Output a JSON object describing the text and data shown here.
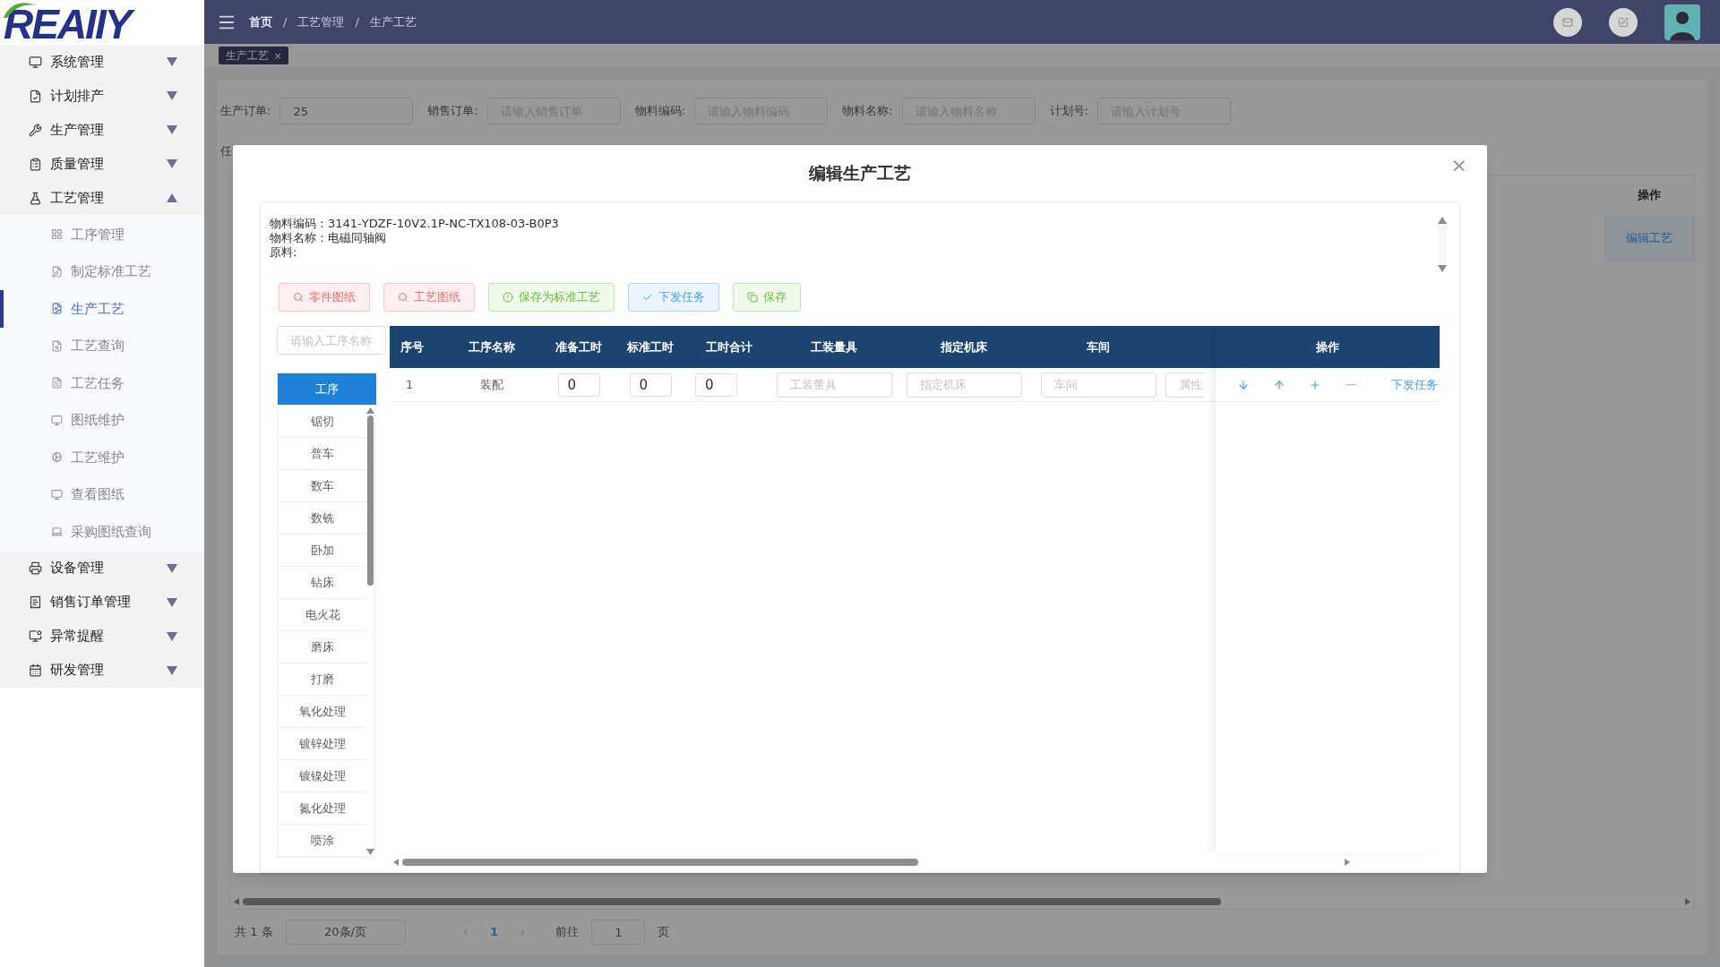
{
  "logo": {
    "text": "REAIIY"
  },
  "sidebar": {
    "items": [
      {
        "label": "系统管理",
        "expanded": false
      },
      {
        "label": "计划排产",
        "expanded": false
      },
      {
        "label": "生产管理",
        "expanded": false
      },
      {
        "label": "质量管理",
        "expanded": false
      },
      {
        "label": "工艺管理",
        "expanded": true,
        "children": [
          {
            "label": "工序管理",
            "selected": false
          },
          {
            "label": "制定标准工艺",
            "selected": false
          },
          {
            "label": "生产工艺",
            "selected": true
          },
          {
            "label": "工艺查询",
            "selected": false
          },
          {
            "label": "工艺任务",
            "selected": false
          },
          {
            "label": "图纸维护",
            "selected": false
          },
          {
            "label": "工艺维护",
            "selected": false
          },
          {
            "label": "查看图纸",
            "selected": false
          },
          {
            "label": "采购图纸查询",
            "selected": false
          }
        ]
      },
      {
        "label": "设备管理",
        "expanded": false
      },
      {
        "label": "销售订单管理",
        "expanded": false
      },
      {
        "label": "异常提醒",
        "expanded": false
      },
      {
        "label": "研发管理",
        "expanded": false
      }
    ]
  },
  "breadcrumb": {
    "items": [
      "首页",
      "工艺管理",
      "生产工艺"
    ],
    "separator": "/"
  },
  "tags": [
    {
      "label": "生产工艺",
      "close": "×",
      "selected": true
    }
  ],
  "filters": [
    {
      "label": "生产订单:",
      "value": "25"
    },
    {
      "label": "销售订单:",
      "placeholder": "请输入销售订单"
    },
    {
      "label": "物料编码:",
      "placeholder": "请输入物料编码"
    },
    {
      "label": "物料名称:",
      "placeholder": "请输入物料名称"
    },
    {
      "label": "计划号:",
      "placeholder": "请输入计划号"
    }
  ],
  "filters_row2": {
    "label": "任"
  },
  "table": {
    "columns": [
      "操作"
    ],
    "rows": [
      {
        "action": "编辑工艺"
      }
    ]
  },
  "pagination": {
    "total": "共 1 条",
    "page_size": "20条/页",
    "prev": "‹",
    "pages": [
      {
        "label": "1",
        "selected": true
      }
    ],
    "next": "›",
    "goto_label": "前往",
    "goto_value": "1",
    "goto_suffix": "页"
  },
  "dialog": {
    "title": "编辑生产工艺",
    "close": "×",
    "info_lines": [
      "物料编码：3141-YDZF-10V2.1P-NC-TX108-03-B0P3",
      "物料名称：电磁同轴阀",
      "原料:"
    ],
    "buttons": [
      {
        "label": "零件图纸",
        "kind": "danger"
      },
      {
        "label": "工艺图纸",
        "kind": "danger"
      },
      {
        "label": "保存为标准工艺",
        "kind": "success"
      },
      {
        "label": "下发任务",
        "kind": "primary"
      },
      {
        "label": "保存",
        "kind": "success"
      }
    ],
    "search": {
      "placeholder": "请输入工序名称"
    },
    "process_list": [
      {
        "label": "工序",
        "selected": true
      },
      {
        "label": "锯切",
        "selected": false
      },
      {
        "label": "普车",
        "selected": false
      },
      {
        "label": "数车",
        "selected": false
      },
      {
        "label": "数铣",
        "selected": false
      },
      {
        "label": "卧加",
        "selected": false
      },
      {
        "label": "钻床",
        "selected": false
      },
      {
        "label": "电火花",
        "selected": false
      },
      {
        "label": "磨床",
        "selected": false
      },
      {
        "label": "打磨",
        "selected": false
      },
      {
        "label": "氧化处理",
        "selected": false
      },
      {
        "label": "镀锌处理",
        "selected": false
      },
      {
        "label": "镀镍处理",
        "selected": false
      },
      {
        "label": "氮化处理",
        "selected": false
      },
      {
        "label": "喷涂",
        "selected": false
      }
    ],
    "table": {
      "columns": [
        "序号",
        "工序名称",
        "准备工时",
        "标准工时",
        "工时合计",
        "工装量具",
        "指定机床",
        "车间"
      ],
      "action_column": "操作",
      "rows": [
        {
          "index": "1",
          "name": "装配",
          "prep_time": "0",
          "std_time": "0",
          "total_time": "0",
          "tooling_placeholder": "工装量具",
          "machine_placeholder": "指定机床",
          "workshop_placeholder": "车间",
          "attribute_placeholder": "属性",
          "actions": [
            {
              "kind": "down",
              "disabled": false
            },
            {
              "kind": "up",
              "disabled": false
            },
            {
              "kind": "add",
              "disabled": false
            },
            {
              "kind": "remove",
              "disabled": true
            }
          ],
          "link": "下发任务"
        }
      ]
    }
  }
}
